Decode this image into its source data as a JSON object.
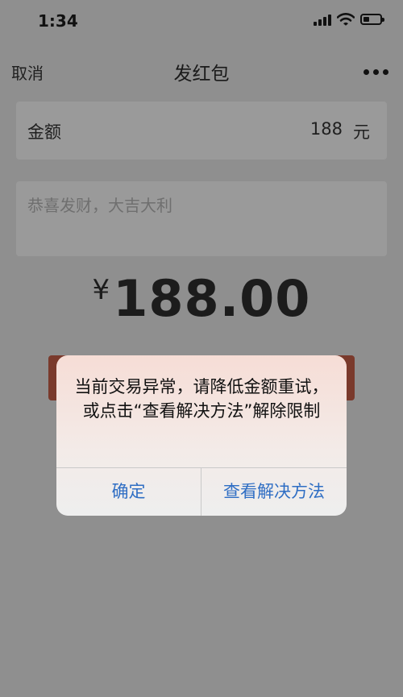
{
  "status_bar": {
    "time": "1:34",
    "icons": [
      "signal-icon",
      "wifi-icon",
      "battery-icon"
    ],
    "battery_level": 0.35
  },
  "nav": {
    "cancel": "取消",
    "title": "发红包",
    "more_icon": "more-icon"
  },
  "amount": {
    "label": "金额",
    "value": "188",
    "unit": "元"
  },
  "greeting": {
    "placeholder": "恭喜发财，大吉大利"
  },
  "total": {
    "symbol": "¥",
    "amount": "188.00"
  },
  "alert": {
    "message": "当前交易异常，请降低金额重试，或点击“查看解决方法”解除限制",
    "confirm": "确定",
    "solution": "查看解决方法"
  },
  "colors": {
    "overlay": "#8f8f8f",
    "button_blue": "#2f6ec4",
    "red_button": "#7a3a2c"
  }
}
